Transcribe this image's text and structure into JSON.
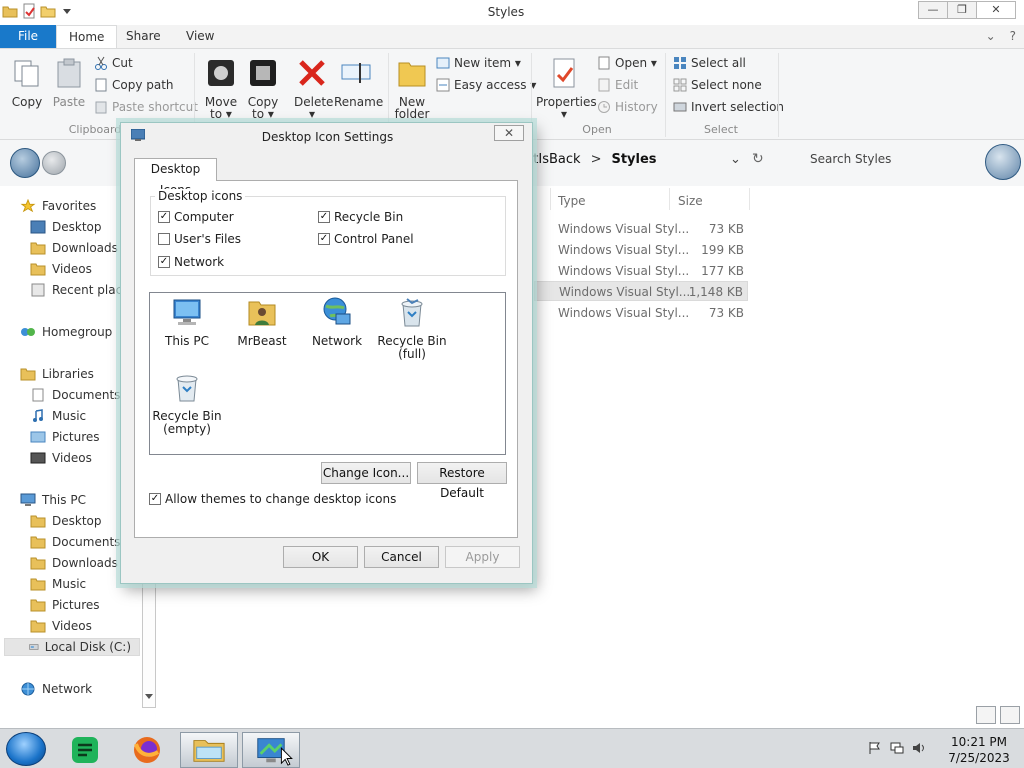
{
  "window": {
    "title": "Styles",
    "buttons": {
      "minimize": "—",
      "maximize": "❐",
      "close": "✕"
    }
  },
  "ribbon": {
    "tabs": {
      "file": "File",
      "home": "Home",
      "share": "Share",
      "view": "View"
    },
    "controls": {
      "collapse": "⌄",
      "help": "?"
    },
    "clipboard": {
      "copy": "Copy",
      "paste": "Paste",
      "cut": "Cut",
      "copy_path": "Copy path",
      "paste_shortcut": "Paste shortcut",
      "group": "Clipboard"
    },
    "organize": {
      "move_to": "Move",
      "move_to_2": "to ▾",
      "copy_to": "Copy",
      "copy_to_2": "to ▾",
      "delete": "Delete",
      "delete_2": "▾",
      "rename": "Rename"
    },
    "new": {
      "new_folder": "New",
      "new_folder_2": "folder",
      "new_item": "New item ▾",
      "easy_access": "Easy access ▾"
    },
    "open": {
      "properties": "Properties",
      "properties_2": "▾",
      "open": "Open ▾",
      "edit": "Edit",
      "history": "History",
      "group": "Open"
    },
    "select": {
      "select_all": "Select all",
      "select_none": "Select none",
      "invert": "Invert selection",
      "group": "Select"
    }
  },
  "address": {
    "crumb1": "artIsBack",
    "sep": ">",
    "crumb2": "Styles",
    "dropdown": "⌄",
    "refresh": "↻",
    "search_placeholder": "Search Styles"
  },
  "nav_pane": {
    "favorites": "Favorites",
    "desktop": "Desktop",
    "downloads": "Downloads",
    "videos": "Videos",
    "recent": "Recent places",
    "homegroup": "Homegroup",
    "libraries": "Libraries",
    "lib_documents": "Documents",
    "lib_music": "Music",
    "lib_pictures": "Pictures",
    "lib_videos": "Videos",
    "this_pc": "This PC",
    "pc_desktop": "Desktop",
    "pc_documents": "Documents",
    "pc_downloads": "Downloads",
    "pc_music": "Music",
    "pc_pictures": "Pictures",
    "pc_videos": "Videos",
    "local_disk": "Local Disk (C:)",
    "network": "Network"
  },
  "file_list": {
    "columns": {
      "type": "Type",
      "size": "Size"
    },
    "rows": [
      {
        "type": "Windows Visual Styl...",
        "size": "73 KB"
      },
      {
        "type": "Windows Visual Styl...",
        "size": "199 KB"
      },
      {
        "type": "Windows Visual Styl...",
        "size": "177 KB"
      },
      {
        "type": "Windows Visual Styl...",
        "size": "1,148 KB"
      },
      {
        "type": "Windows Visual Styl...",
        "size": "73 KB"
      }
    ]
  },
  "dialog": {
    "title": "Desktop Icon Settings",
    "close": "✕",
    "tab": "Desktop Icons",
    "group_label": "Desktop icons",
    "checkboxes": {
      "computer": "Computer",
      "recycle_bin": "Recycle Bin",
      "users_files": "User's Files",
      "control_panel": "Control Panel",
      "network": "Network"
    },
    "checked": {
      "computer": true,
      "recycle_bin": true,
      "users_files": false,
      "control_panel": true,
      "network": true,
      "allow_themes": true
    },
    "icons": {
      "this_pc": "This PC",
      "mrbeast": "MrBeast",
      "network": "Network",
      "bin_full": "Recycle Bin",
      "bin_full_2": "(full)",
      "bin_empty": "Recycle Bin",
      "bin_empty_2": "(empty)"
    },
    "change_icon": "Change Icon...",
    "restore_default": "Restore Default",
    "allow_themes": "Allow themes to change desktop icons",
    "ok": "OK",
    "cancel": "Cancel",
    "apply": "Apply"
  },
  "taskbar": {
    "time": "10:21 PM",
    "date": "7/25/2023"
  },
  "colors": {
    "accent": "#1979ca",
    "dialog_border": "#9bc6c2",
    "taskbar": "#d9dcdf"
  }
}
